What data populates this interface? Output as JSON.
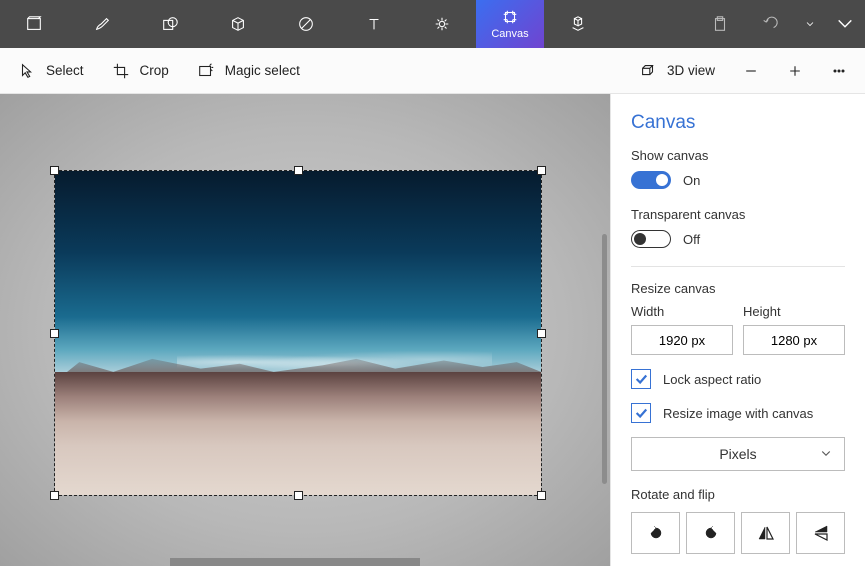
{
  "topbar": {
    "canvas_label": "Canvas"
  },
  "toolbar": {
    "select": "Select",
    "crop": "Crop",
    "magic_select": "Magic select",
    "view_3d": "3D view"
  },
  "panel": {
    "title": "Canvas",
    "show_canvas": {
      "label": "Show canvas",
      "state": "On"
    },
    "transparent_canvas": {
      "label": "Transparent canvas",
      "state": "Off"
    },
    "resize": {
      "title": "Resize canvas",
      "width_label": "Width",
      "height_label": "Height",
      "width_value": "1920 px",
      "height_value": "1280 px",
      "lock_aspect": "Lock aspect ratio",
      "resize_image": "Resize image with canvas",
      "units": "Pixels"
    },
    "rotate": {
      "title": "Rotate and flip"
    }
  }
}
